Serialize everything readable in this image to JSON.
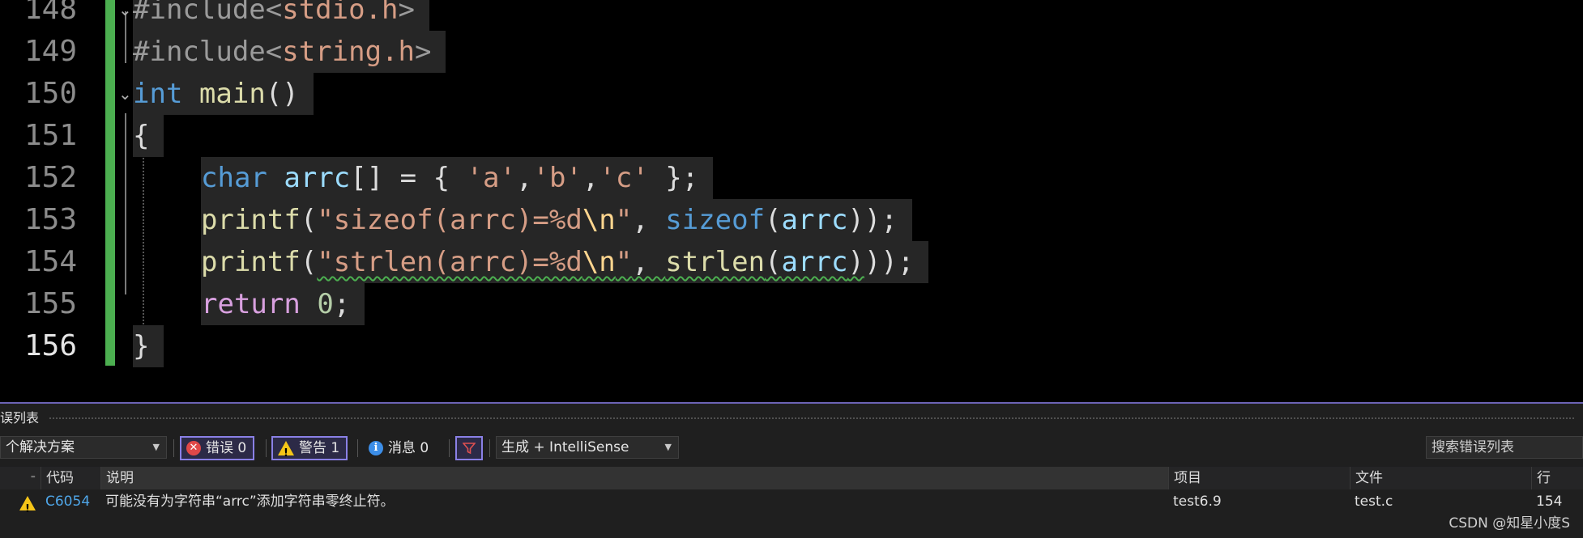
{
  "editor": {
    "lines": [
      {
        "number": "148",
        "tokens": [
          [
            "pre",
            "#include<"
          ],
          [
            "str",
            "stdio.h"
          ],
          [
            "pre",
            ">"
          ]
        ]
      },
      {
        "number": "149",
        "tokens": [
          [
            "pre",
            "#include<"
          ],
          [
            "str",
            "string.h"
          ],
          [
            "pre",
            ">"
          ]
        ]
      },
      {
        "number": "150",
        "tokens": [
          [
            "kw-blue",
            "int"
          ],
          [
            "punc",
            " "
          ],
          [
            "fn",
            "main"
          ],
          [
            "punc",
            "()"
          ]
        ]
      },
      {
        "number": "151",
        "tokens": [
          [
            "punc",
            "{"
          ]
        ]
      },
      {
        "number": "152",
        "tokens": [
          [
            "kw-blue",
            "char"
          ],
          [
            "punc",
            " "
          ],
          [
            "var",
            "arrc"
          ],
          [
            "punc",
            "[] = { "
          ],
          [
            "str",
            "'a'"
          ],
          [
            "punc",
            ","
          ],
          [
            "str",
            "'b'"
          ],
          [
            "punc",
            ","
          ],
          [
            "str",
            "'c'"
          ],
          [
            "punc",
            " };"
          ]
        ]
      },
      {
        "number": "153",
        "tokens": [
          [
            "fn",
            "printf"
          ],
          [
            "punc",
            "("
          ],
          [
            "str",
            "\"sizeof(arrc)=%d"
          ],
          [
            "esc",
            "\\n"
          ],
          [
            "str",
            "\""
          ],
          [
            "punc",
            ", "
          ],
          [
            "kw-blue",
            "sizeof"
          ],
          [
            "punc",
            "("
          ],
          [
            "var",
            "arrc"
          ],
          [
            "punc",
            "));"
          ]
        ]
      },
      {
        "number": "154",
        "tokens": [
          [
            "fn",
            "printf"
          ],
          [
            "punc",
            "("
          ],
          [
            "str squiggle",
            "\"strlen(arrc)=%d"
          ],
          [
            "esc squiggle",
            "\\n"
          ],
          [
            "str squiggle",
            "\""
          ],
          [
            "punc squiggle",
            ", "
          ],
          [
            "fn squiggle",
            "strlen"
          ],
          [
            "punc squiggle",
            "("
          ],
          [
            "var squiggle",
            "arrc"
          ],
          [
            "punc squiggle",
            ")"
          ],
          [
            "punc",
            "));"
          ]
        ]
      },
      {
        "number": "155",
        "tokens": [
          [
            "kw-purple",
            "return"
          ],
          [
            "punc",
            " "
          ],
          [
            "num",
            "0"
          ],
          [
            "punc",
            ";"
          ]
        ]
      },
      {
        "number": "156",
        "tokens": [
          [
            "punc",
            "}"
          ]
        ]
      }
    ]
  },
  "panel": {
    "title": "误列表",
    "scope_dropdown": "个解决方案",
    "errors_btn": "错误 0",
    "warnings_btn": "警告 1",
    "messages_btn": "消息 0",
    "build_dropdown": "生成 + IntelliSense",
    "search_placeholder": "搜索错误列表",
    "columns": {
      "code": "代码",
      "description": "说明",
      "project": "项目",
      "file": "文件",
      "line": "行"
    },
    "rows": [
      {
        "code": "C6054",
        "description": "可能没有为字符串“arrc”添加字符串零终止符。",
        "project": "test6.9",
        "file": "test.c",
        "line": "154"
      }
    ]
  },
  "watermark": "CSDN @知星小度S",
  "colors": {
    "accent": "#8a80e6",
    "gutter_green": "#4caf50",
    "keyword": "#569cd6",
    "function": "#dcdcaa",
    "string": "#d69d85",
    "variable": "#9cdcfe"
  }
}
